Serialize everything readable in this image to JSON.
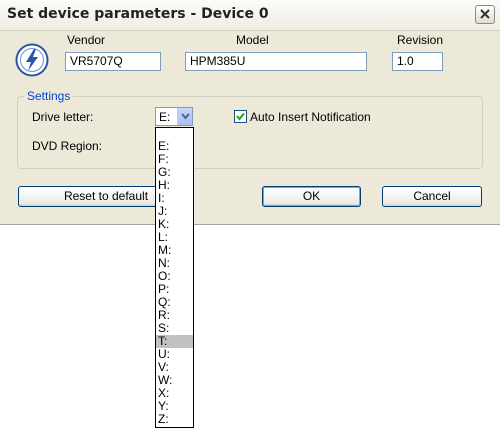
{
  "window": {
    "title": "Set device parameters - Device 0"
  },
  "device": {
    "vendor_label": "Vendor",
    "vendor_value": "VR5707Q",
    "model_label": "Model",
    "model_value": "HPM385U",
    "revision_label": "Revision",
    "revision_value": "1.0"
  },
  "settings": {
    "group_label": "Settings",
    "drive_letter_label": "Drive letter:",
    "drive_letter_value": "E:",
    "auto_insert_label": "Auto Insert Notification",
    "auto_insert_checked": true,
    "dvd_region_label": "DVD Region:"
  },
  "buttons": {
    "reset": "Reset to default",
    "ok": "OK",
    "cancel": "Cancel"
  },
  "dropdown": {
    "options": [
      "E:",
      "F:",
      "G:",
      "H:",
      "I:",
      "J:",
      "K:",
      "L:",
      "M:",
      "N:",
      "O:",
      "P:",
      "Q:",
      "R:",
      "S:",
      "T:",
      "U:",
      "V:",
      "W:",
      "X:",
      "Y:",
      "Z:"
    ],
    "highlighted": "T:"
  },
  "icons": {
    "logo": "lightning-disc-icon",
    "close": "close-icon",
    "combo_arrow": "chevron-down-icon",
    "check": "checkmark-icon"
  },
  "colors": {
    "dialog_bg": "#ece9d8",
    "group_label": "#0046d5",
    "highlight": "#c1c1c1"
  }
}
